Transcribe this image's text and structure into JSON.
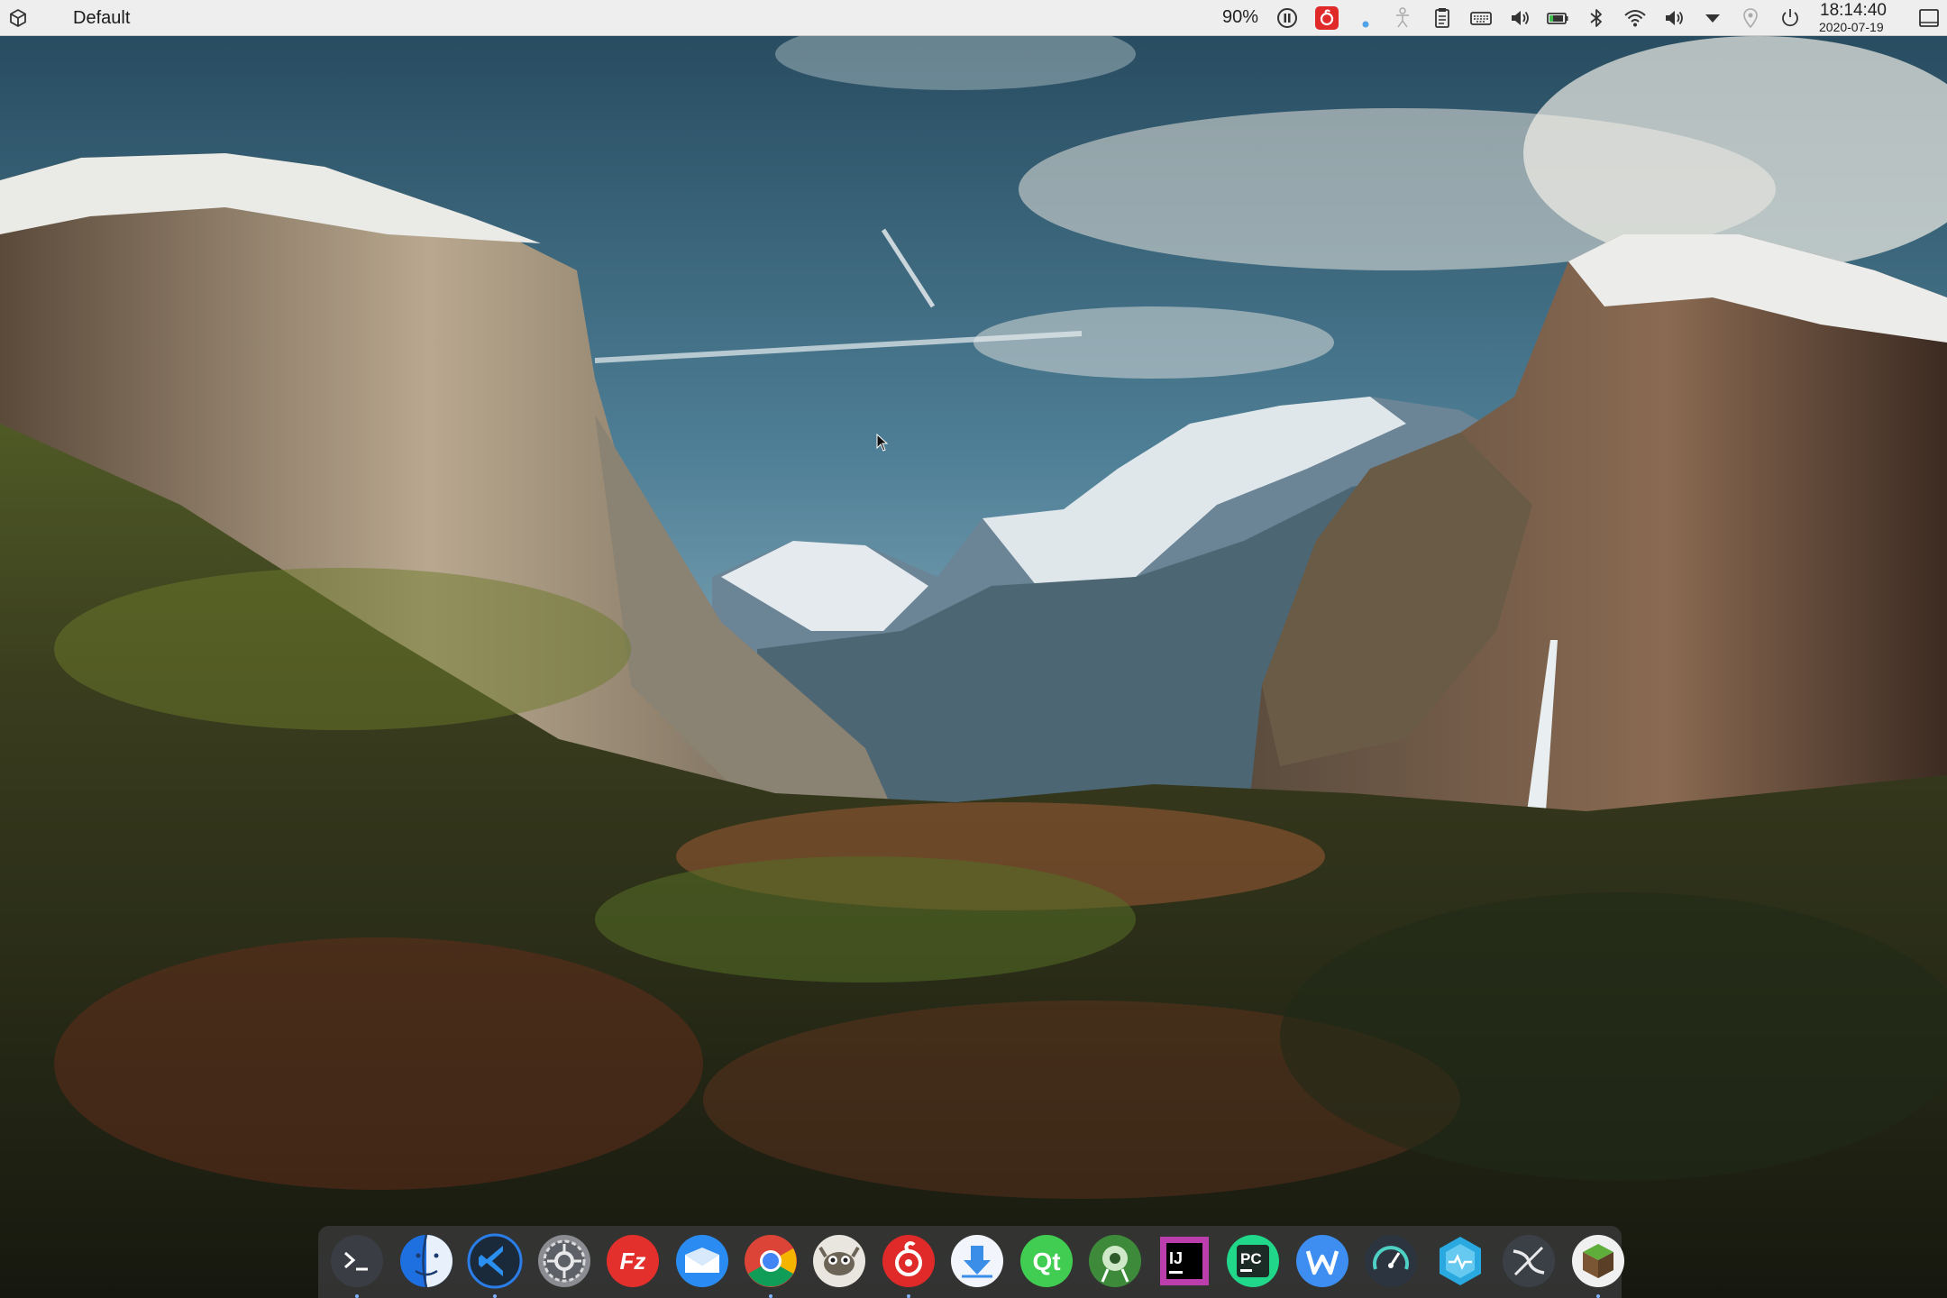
{
  "panel": {
    "window_title": "Default",
    "battery_percent": "90%",
    "clock": {
      "time": "18:14:40",
      "date": "2020-07-19"
    }
  },
  "tray_icons": [
    "pause-icon",
    "netease-music-icon",
    "notification-dot-icon",
    "accessibility-icon",
    "clipboard-icon",
    "keyboard-icon",
    "volume-icon",
    "battery-icon",
    "bluetooth-icon",
    "wifi-icon",
    "volume-icon-2",
    "expand-arrow-icon",
    "location-icon",
    "power-icon",
    "show-desktop-icon"
  ],
  "dock_apps": [
    {
      "name": "Terminal",
      "icon": "terminal-icon",
      "running": true
    },
    {
      "name": "Finder",
      "icon": "finder-icon",
      "running": false
    },
    {
      "name": "Visual Studio Code",
      "icon": "vscode-icon",
      "running": true
    },
    {
      "name": "System Settings",
      "icon": "settings-gear-icon",
      "running": false
    },
    {
      "name": "FileZilla",
      "icon": "filezilla-icon",
      "running": false
    },
    {
      "name": "Mail",
      "icon": "mail-icon",
      "running": false
    },
    {
      "name": "Chrome",
      "icon": "chrome-icon",
      "running": true
    },
    {
      "name": "GIMP",
      "icon": "gimp-icon",
      "running": false
    },
    {
      "name": "NetEase Cloud Music",
      "icon": "netease-music-icon",
      "running": true
    },
    {
      "name": "Downloader",
      "icon": "download-icon",
      "running": false
    },
    {
      "name": "Qt Creator",
      "icon": "qt-icon",
      "running": false
    },
    {
      "name": "Android Studio",
      "icon": "android-studio-icon",
      "running": false
    },
    {
      "name": "IntelliJ IDEA",
      "icon": "intellij-icon",
      "running": false
    },
    {
      "name": "PyCharm",
      "icon": "pycharm-icon",
      "running": false
    },
    {
      "name": "Writer",
      "icon": "writer-w-icon",
      "running": false
    },
    {
      "name": "System Monitor",
      "icon": "gauge-icon",
      "running": false
    },
    {
      "name": "Hexagon App",
      "icon": "hexagon-icon",
      "running": false
    },
    {
      "name": "Blender",
      "icon": "blender-icon",
      "running": false
    },
    {
      "name": "Minecraft",
      "icon": "minecraft-icon",
      "running": true
    }
  ],
  "colors": {
    "panel_bg": "#eeeeef",
    "accent_blue": "#2b7de9",
    "dock_bg": "#48484e"
  }
}
